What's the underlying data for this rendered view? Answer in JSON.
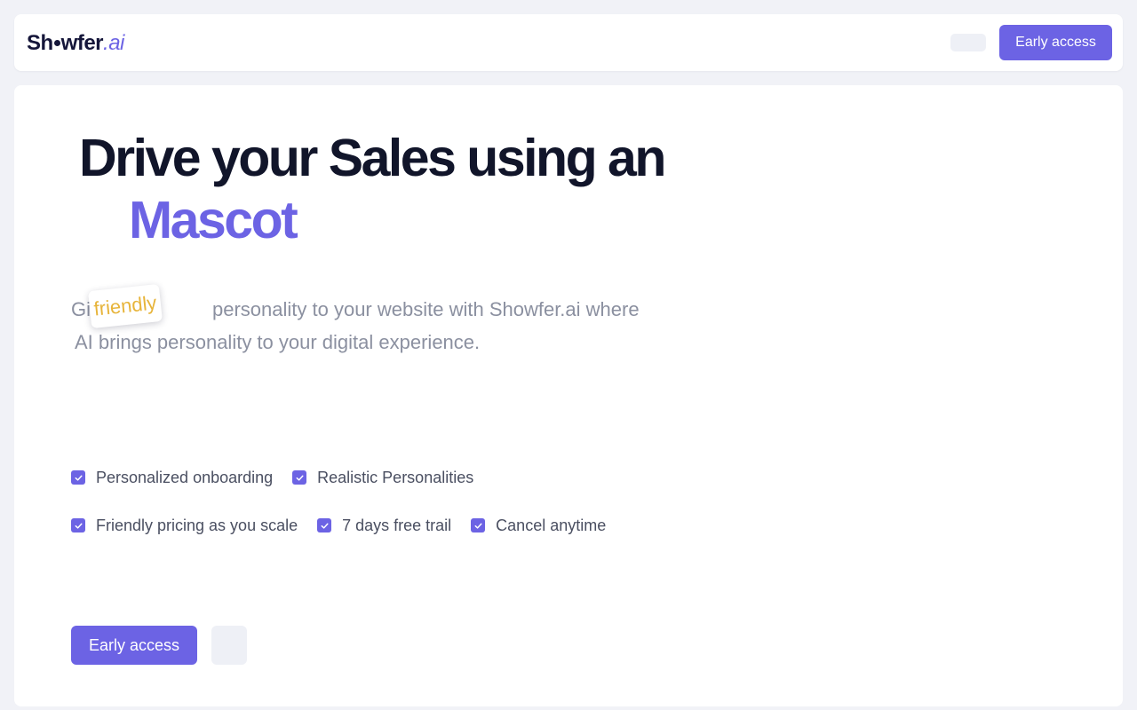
{
  "brand": {
    "logo_prefix": "Sh",
    "logo_middle": "wfer",
    "logo_suffix": ".ai",
    "accent_color": "#6c63e4"
  },
  "nav": {
    "cta_label": "Early access"
  },
  "hero": {
    "title_line1": "Drive your Sales using an",
    "title_highlight": "Mascot",
    "subtitle_start": "Gi",
    "sticker_word": "friendly",
    "subtitle_rest": "personality to your website with Showfer.ai where",
    "subtitle_line2": "AI brings personality to your digital experience.",
    "cta_label": "Early access"
  },
  "features": {
    "row1": [
      "Personalized onboarding",
      "Realistic Personalities"
    ],
    "row2": [
      "Friendly pricing as you scale",
      "7 days free trail",
      "Cancel anytime"
    ]
  },
  "icons": {
    "check": "check-icon"
  }
}
